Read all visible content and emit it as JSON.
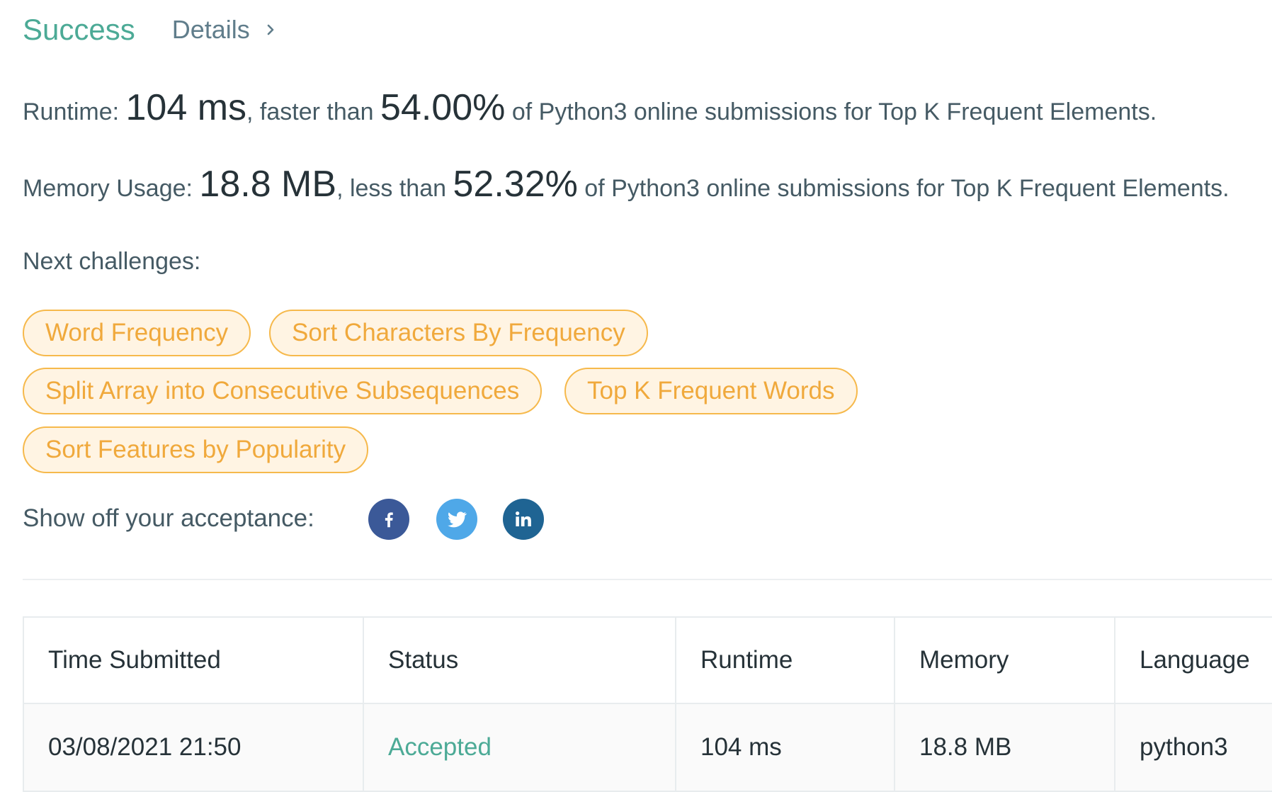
{
  "header": {
    "status": "Success",
    "details_label": "Details"
  },
  "runtime": {
    "label": "Runtime: ",
    "value": "104 ms",
    "comparison": ", faster than ",
    "percent": "54.00%",
    "suffix": " of Python3 online submissions for Top K Frequent Elements."
  },
  "memory": {
    "label": "Memory Usage: ",
    "value": "18.8 MB",
    "comparison": ", less than ",
    "percent": "52.32%",
    "suffix": " of Python3 online submissions for Top K Frequent Elements."
  },
  "next_challenges": {
    "label": "Next challenges:",
    "items": [
      "Word Frequency",
      "Sort Characters By Frequency",
      "Split Array into Consecutive Subsequences",
      "Top K Frequent Words",
      "Sort Features by Popularity"
    ]
  },
  "share": {
    "label": "Show off your acceptance:",
    "icons": [
      "facebook-icon",
      "twitter-icon",
      "linkedin-icon"
    ],
    "colors": {
      "facebook": "#3b5998",
      "twitter": "#4fa8e8",
      "linkedin": "#1f6493"
    }
  },
  "table": {
    "headers": [
      "Time Submitted",
      "Status",
      "Runtime",
      "Memory",
      "Language"
    ],
    "rows": [
      [
        "03/08/2021 21:50",
        "Accepted",
        "104 ms",
        "18.8 MB",
        "python3"
      ]
    ]
  },
  "colors": {
    "success": "#4caa96",
    "tag_border": "#f6b94c",
    "tag_text": "#f0a93c",
    "tag_bg": "#fff4e3"
  }
}
